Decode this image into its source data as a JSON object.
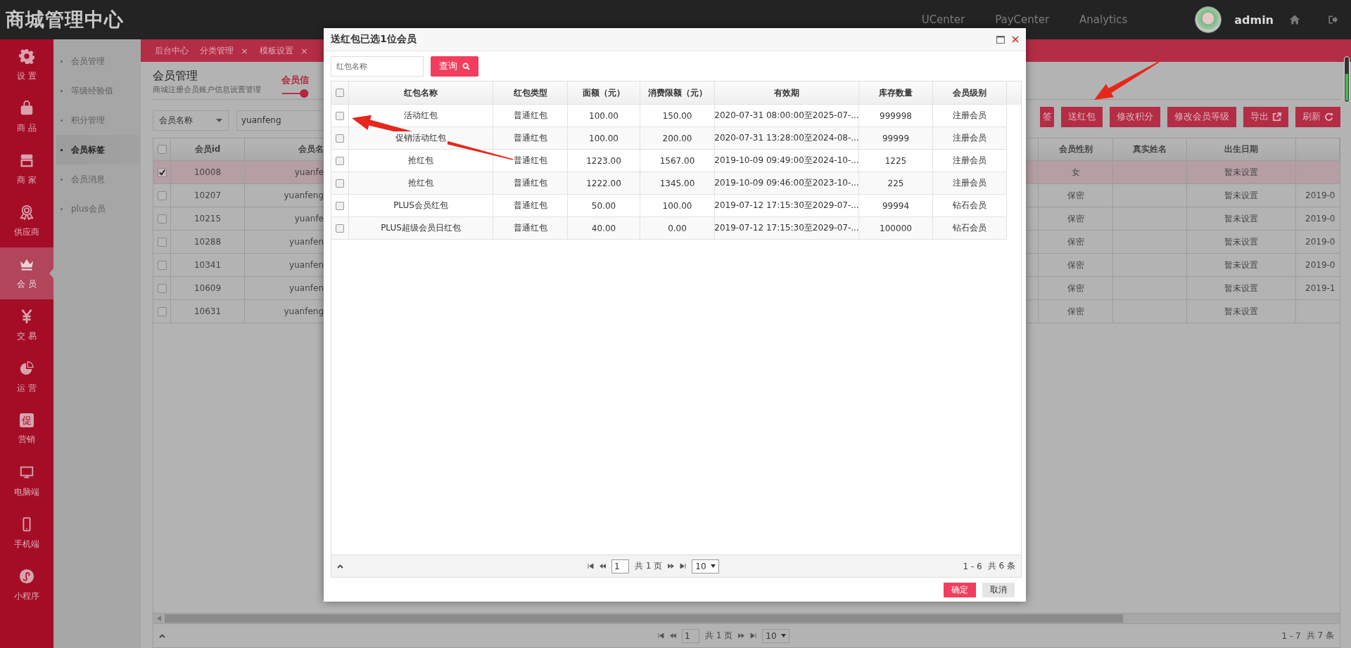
{
  "header": {
    "title": "商城管理中心",
    "links": [
      "UCenter",
      "PayCenter",
      "Analytics"
    ],
    "user": "admin"
  },
  "rail": [
    {
      "label": "设 置",
      "kind": "gear",
      "selected": false
    },
    {
      "label": "商 品",
      "kind": "bag",
      "selected": false
    },
    {
      "label": "商 家",
      "kind": "shop",
      "selected": false
    },
    {
      "label": "供应商",
      "kind": "award",
      "selected": false
    },
    {
      "label": "会 员",
      "kind": "crown",
      "selected": true
    },
    {
      "label": "交 易",
      "kind": "yen",
      "selected": false
    },
    {
      "label": "运 营",
      "kind": "pie",
      "selected": false
    },
    {
      "label": "营销",
      "kind": "promo",
      "badge": "促",
      "selected": false
    },
    {
      "label": "电脑端",
      "kind": "monitor",
      "selected": false
    },
    {
      "label": "手机端",
      "kind": "phone",
      "selected": false
    },
    {
      "label": "小程序",
      "kind": "mini",
      "selected": false
    }
  ],
  "submenu": [
    {
      "label": "会员管理",
      "selected": false
    },
    {
      "label": "等级经验值",
      "selected": false
    },
    {
      "label": "积分管理",
      "selected": false
    },
    {
      "label": "会员标签",
      "selected": true
    },
    {
      "label": "会员消息",
      "selected": false
    },
    {
      "label": "plus会员",
      "selected": false
    }
  ],
  "tabs": [
    {
      "label": "后台中心"
    },
    {
      "label": "分类管理",
      "close": "×"
    },
    {
      "label": "模板设置",
      "close": "×"
    }
  ],
  "page": {
    "title": "会员管理",
    "subtitle": "商城注册会员账户信息设置管理",
    "step": "会员信"
  },
  "filter": {
    "field": "会员名称",
    "value": "yuanfeng"
  },
  "actions": [
    {
      "label": "签",
      "kind": "plain"
    },
    {
      "label": "送红包",
      "kind": "plain"
    },
    {
      "label": "修改积分",
      "kind": "plain"
    },
    {
      "label": "修改会员等级",
      "kind": "plain"
    },
    {
      "label": "导出",
      "kind": "export"
    },
    {
      "label": "刷新",
      "kind": "refresh"
    }
  ],
  "member_table": {
    "all_checked": false,
    "columns": [
      "会员id",
      "会员名",
      "会员性别",
      "真实姓名",
      "出生日期"
    ],
    "rows": [
      {
        "checked": true,
        "id": "10008",
        "name": "yuanfe",
        "gender": "女",
        "birthday": "暂未设置"
      },
      {
        "checked": false,
        "id": "10207",
        "name": "yuanfeng",
        "gender": "保密",
        "birthday": "暂未设置",
        "column_8": "2019-0"
      },
      {
        "checked": false,
        "id": "10215",
        "name": "yuanfe",
        "gender": "保密",
        "birthday": "暂未设置",
        "column_8": "2019-0"
      },
      {
        "checked": false,
        "id": "10288",
        "name": "yuanfen",
        "gender": "保密",
        "birthday": "暂未设置",
        "column_8": "2019-0"
      },
      {
        "checked": false,
        "id": "10341",
        "name": "yuanfen",
        "gender": "保密",
        "birthday": "暂未设置",
        "column_8": "2019-0"
      },
      {
        "checked": false,
        "id": "10609",
        "name": "yuanfen",
        "gender": "保密",
        "birthday": "暂未设置",
        "column_8": "2019-1"
      },
      {
        "checked": false,
        "id": "10631",
        "name": "yuanfeng",
        "gender": "保密",
        "birthday": "暂未设置"
      }
    ]
  },
  "pager": {
    "page": "1",
    "pages": "共 1 页",
    "size": "10",
    "range": "1 - 7",
    "total": "共 7 条"
  },
  "dialog": {
    "title": "送红包已选1位会员",
    "search": {
      "placeholder": "红包名称",
      "button": "查询"
    },
    "all_checked": false,
    "columns": [
      "红包名称",
      "红包类型",
      "面额（元）",
      "消费限额（元）",
      "有效期",
      "库存数量",
      "会员级别"
    ],
    "rows": [
      {
        "checked": false,
        "name": "活动红包",
        "type": "普通红包",
        "amount": "100.00",
        "limit": "150.00",
        "valid": "2020-07-31 08:00:00至2025-07-...",
        "stock": "999998",
        "level": "注册会员"
      },
      {
        "checked": false,
        "name": "促销活动红包",
        "type": "普通红包",
        "amount": "100.00",
        "limit": "200.00",
        "valid": "2020-07-31 13:28:00至2024-08-...",
        "stock": "99999",
        "level": "注册会员"
      },
      {
        "checked": false,
        "name": "抢红包",
        "type": "普通红包",
        "amount": "1223.00",
        "limit": "1567.00",
        "valid": "2019-10-09 09:49:00至2024-10-...",
        "stock": "1225",
        "level": "注册会员"
      },
      {
        "checked": false,
        "name": "抢红包",
        "type": "普通红包",
        "amount": "1222.00",
        "limit": "1345.00",
        "valid": "2019-10-09 09:46:00至2023-10-...",
        "stock": "225",
        "level": "注册会员"
      },
      {
        "checked": false,
        "name": "PLUS会员红包",
        "type": "普通红包",
        "amount": "50.00",
        "limit": "100.00",
        "valid": "2019-07-12 17:15:30至2029-07-...",
        "stock": "99994",
        "level": "钻石会员"
      },
      {
        "checked": false,
        "name": "PLUS超级会员日红包",
        "type": "普通红包",
        "amount": "40.00",
        "limit": "0.00",
        "valid": "2019-07-12 17:15:30至2029-07-...",
        "stock": "100000",
        "level": "钻石会员"
      }
    ],
    "pager": {
      "page": "1",
      "pages": "共 1 页",
      "size": "10",
      "range": "1 - 6",
      "total": "共 6 条"
    },
    "buttons": [
      "确定",
      "取消"
    ]
  }
}
